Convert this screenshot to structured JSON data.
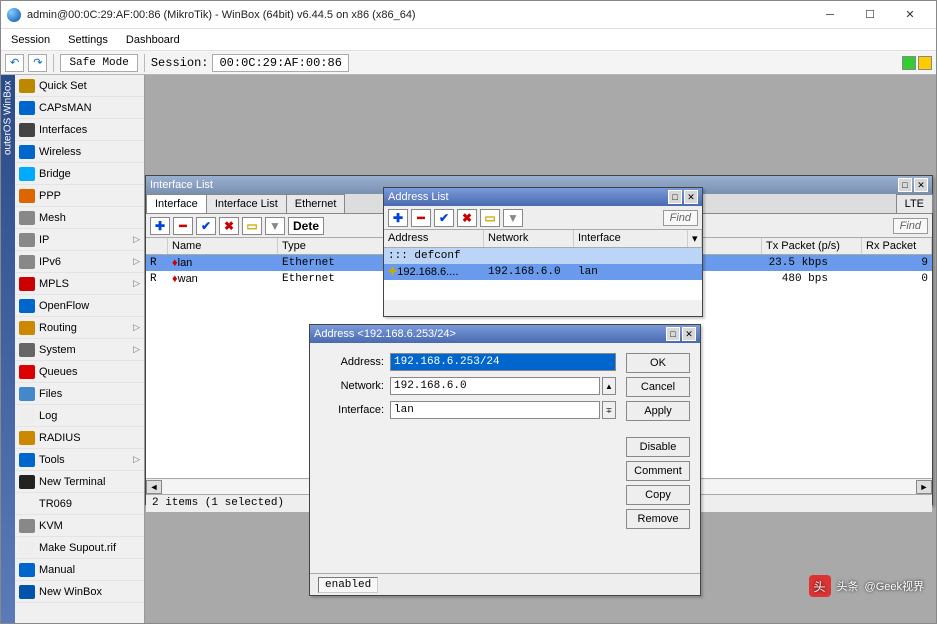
{
  "window": {
    "title": "admin@00:0C:29:AF:00:86 (MikroTik) - WinBox (64bit) v6.44.5 on x86 (x86_64)"
  },
  "menu": {
    "items": [
      "Session",
      "Settings",
      "Dashboard"
    ]
  },
  "toolbar": {
    "safe_mode": "Safe Mode",
    "session_label": "Session:",
    "session_value": "00:0C:29:AF:00:86"
  },
  "sidebar_rail": "outerOS WinBox",
  "sidebar": {
    "items": [
      {
        "label": "Quick Set",
        "icon": "#b80",
        "arrow": false
      },
      {
        "label": "CAPsMAN",
        "icon": "#06c",
        "arrow": false
      },
      {
        "label": "Interfaces",
        "icon": "#444",
        "arrow": false
      },
      {
        "label": "Wireless",
        "icon": "#06c",
        "arrow": false
      },
      {
        "label": "Bridge",
        "icon": "#0af",
        "arrow": false
      },
      {
        "label": "PPP",
        "icon": "#d60",
        "arrow": false
      },
      {
        "label": "Mesh",
        "icon": "#888",
        "arrow": false
      },
      {
        "label": "IP",
        "icon": "#888",
        "arrow": true
      },
      {
        "label": "IPv6",
        "icon": "#888",
        "arrow": true
      },
      {
        "label": "MPLS",
        "icon": "#c00",
        "arrow": true
      },
      {
        "label": "OpenFlow",
        "icon": "#06c",
        "arrow": false
      },
      {
        "label": "Routing",
        "icon": "#c80",
        "arrow": true
      },
      {
        "label": "System",
        "icon": "#666",
        "arrow": true
      },
      {
        "label": "Queues",
        "icon": "#d00",
        "arrow": false
      },
      {
        "label": "Files",
        "icon": "#48c",
        "arrow": false
      },
      {
        "label": "Log",
        "icon": "#eee",
        "arrow": false
      },
      {
        "label": "RADIUS",
        "icon": "#c80",
        "arrow": false
      },
      {
        "label": "Tools",
        "icon": "#06c",
        "arrow": true
      },
      {
        "label": "New Terminal",
        "icon": "#222",
        "arrow": false
      },
      {
        "label": "TR069",
        "icon": "none",
        "arrow": false
      },
      {
        "label": "KVM",
        "icon": "#888",
        "arrow": false
      },
      {
        "label": "Make Supout.rif",
        "icon": "#eee",
        "arrow": false
      },
      {
        "label": "Manual",
        "icon": "#06c",
        "arrow": false
      },
      {
        "label": "New WinBox",
        "icon": "#05a",
        "arrow": false
      }
    ]
  },
  "interface_list": {
    "title": "Interface List",
    "tabs": [
      "Interface",
      "Interface List",
      "Ethernet"
    ],
    "extra_tab": "LTE",
    "detect_btn": "Dete",
    "find": "Find",
    "columns": [
      "",
      "Name",
      "Type",
      "Tx Packet (p/s)",
      "Rx Packet"
    ],
    "rate_col": "23.5 kbps",
    "rows": [
      {
        "flag": "R",
        "name": "lan",
        "type": "Ethernet",
        "rate": "23.5 kbps",
        "txp": "9"
      },
      {
        "flag": "R",
        "name": "wan",
        "type": "Ethernet",
        "rate": "480 bps",
        "txp": "0"
      }
    ],
    "status": "2 items (1 selected)"
  },
  "address_list": {
    "title": "Address List",
    "find": "Find",
    "columns": [
      "Address",
      "Network",
      "Interface"
    ],
    "group_row": "::: defconf",
    "row": {
      "addr": "192.168.6....",
      "net": "192.168.6.0",
      "iface": "lan"
    }
  },
  "address_dialog": {
    "title": "Address <192.168.6.253/24>",
    "fields": {
      "address_label": "Address:",
      "address_value": "192.168.6.253/24",
      "network_label": "Network:",
      "network_value": "192.168.6.0",
      "interface_label": "Interface:",
      "interface_value": "lan"
    },
    "buttons": {
      "ok": "OK",
      "cancel": "Cancel",
      "apply": "Apply",
      "disable": "Disable",
      "comment": "Comment",
      "copy": "Copy",
      "remove": "Remove"
    },
    "status": "enabled"
  },
  "watermark": {
    "text": "@Geek视界",
    "sub": "头条"
  }
}
